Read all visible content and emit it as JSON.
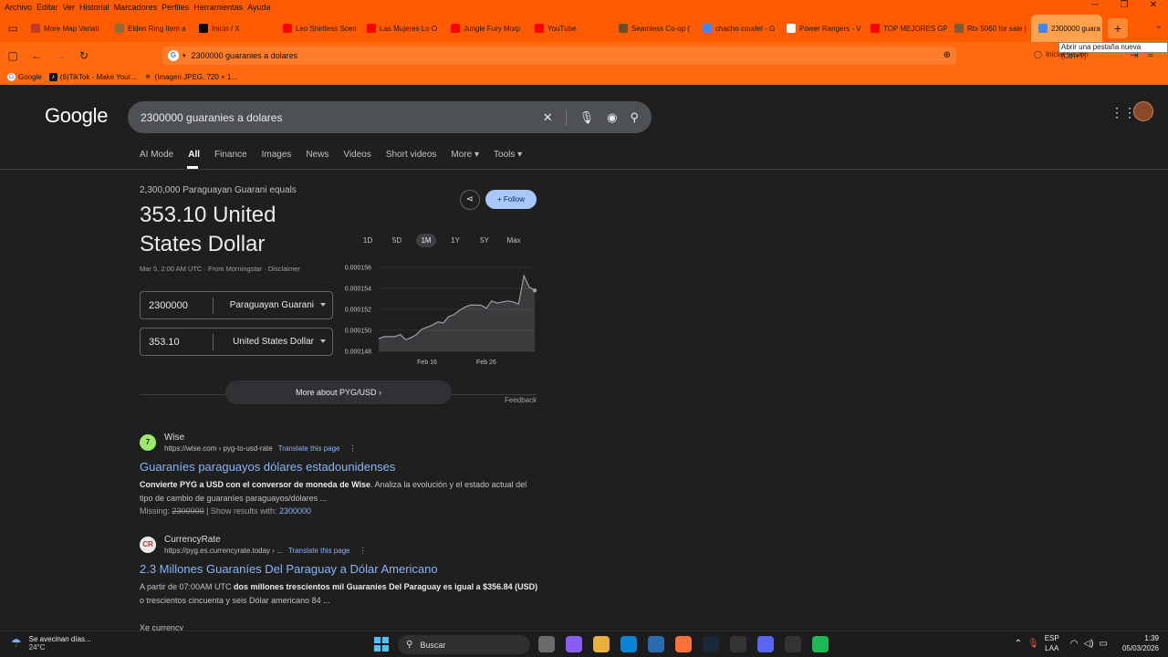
{
  "menubar": {
    "items": [
      "Archivo",
      "Editar",
      "Ver",
      "Historial",
      "Marcadores",
      "Perfiles",
      "Herramientas",
      "Ayuda"
    ]
  },
  "tabs": [
    {
      "label": "More Map Variati",
      "color": "#c0392b"
    },
    {
      "label": "Elden Ring Item a",
      "color": "#8e6b3a"
    },
    {
      "label": "Inicio / X",
      "color": "#000000"
    },
    {
      "label": "Leo Shirtless Scen",
      "color": "#ff0000"
    },
    {
      "label": "Las Mujeres Lo O",
      "color": "#ff0000"
    },
    {
      "label": "Jungle Fury Morp",
      "color": "#ff0000"
    },
    {
      "label": "YouTube",
      "color": "#ff0000"
    },
    {
      "label": "Seamless Co-op (",
      "color": "#6b4f2a"
    },
    {
      "label": "chacho coudet - G",
      "color": "#4285f4"
    },
    {
      "label": "Power Rangers - V",
      "color": "#ffffff"
    },
    {
      "label": "TOP MEJORES GP",
      "color": "#ff0000"
    },
    {
      "label": "Rtx 5060 for sale |",
      "color": "#7a5b3a"
    },
    {
      "label": "2300000 guara",
      "color": "#4285f4",
      "active": true
    }
  ],
  "tooltip": "Abrir una pestaña nueva (Ctrl+T)",
  "address": {
    "url": "2300000 guaranies a dolares"
  },
  "signin": "Iniciar sesión",
  "bookmarks": [
    {
      "label": "Google",
      "icon": "G"
    },
    {
      "label": "(6)TikTok - Make Your...",
      "icon": "♪"
    },
    {
      "label": "(Imagen JPEG, 720 × 1...",
      "icon": "⊕"
    }
  ],
  "google": {
    "logo": "Google",
    "query": "2300000 guaranies a dolares",
    "tabs": [
      "AI Mode",
      "All",
      "Finance",
      "Images",
      "News",
      "Videos",
      "Short videos",
      "More ▾",
      "Tools ▾"
    ]
  },
  "converter": {
    "equals": "2,300,000 Paraguayan Guarani equals",
    "result": "353.10 United States Dollar",
    "meta": "Mar 5, 2:00 AM UTC · From Morningstar · Disclaimer",
    "from_amount": "2300000",
    "from_currency": "Paraguayan Guarani",
    "to_amount": "353.10",
    "to_currency": "United States Dollar",
    "follow": "Follow",
    "ranges": [
      "1D",
      "5D",
      "1M",
      "1Y",
      "5Y",
      "Max"
    ],
    "selected_range": "1M",
    "more": "More about PYG/USD",
    "feedback": "Feedback"
  },
  "chart_data": {
    "type": "area",
    "title": "",
    "xlabel": "",
    "ylabel": "",
    "x_ticks": [
      "Feb 16",
      "Feb 26"
    ],
    "y_ticks": [
      "0.000156",
      "0.000154",
      "0.000152",
      "0.000150",
      "0.000148"
    ],
    "ylim": [
      0.000148,
      0.000156
    ],
    "series": [
      {
        "name": "",
        "values": [
          0.0001492,
          0.0001494,
          0.0001494,
          0.0001494,
          0.0001496,
          0.0001491,
          0.0001493,
          0.0001496,
          0.0001501,
          0.0001503,
          0.0001505,
          0.0001508,
          0.0001507,
          0.0001513,
          0.0001515,
          0.0001519,
          0.0001522,
          0.0001524,
          0.0001524,
          0.0001524,
          0.0001521,
          0.0001528,
          0.0001526,
          0.0001527,
          0.0001528,
          0.0001527,
          0.0001525,
          0.0001552,
          0.0001541,
          0.0001538
        ]
      }
    ]
  },
  "results": [
    {
      "site": "Wise",
      "url": "https://wise.com › pyg-to-usd-rate",
      "translate": "Translate this page",
      "title": "Guaraníes paraguayos dólares estadounidenses",
      "snippet_bold": "Convierte PYG a USD con el conversor de moneda de Wise",
      "snippet_rest": ". Analiza la evolución y el estado actual del tipo de cambio de guaraníes paraguayos/dólares ...",
      "missing_label": "Missing:",
      "missing_value": "2300000",
      "show_label": "| Show results with:",
      "show_value": "2300000",
      "icon": "7",
      "icon_bg": "#9fe870",
      "icon_fg": "#163300"
    },
    {
      "site": "CurrencyRate",
      "url": "https://pyg.es.currencyrate.today › ...",
      "translate": "Translate this page",
      "title": "2.3 Millones Guaraníes Del Paraguay a Dólar Americano",
      "snippet_a": "A partir de 07:00AM UTC ",
      "snippet_bold": "dos millones trescientos mil Guaraníes Del Paraguay es igual a $356.84 (USD)",
      "snippet_rest": " o trescientos cincuenta y seis Dólar americano 84 ...",
      "icon": "CR",
      "icon_bg": "#e8eaed",
      "icon_fg": "#c0392b"
    }
  ],
  "result3_partial": "Xe currency",
  "taskbar": {
    "weather_text": "Se avecinan días...",
    "temp": "24°C",
    "search": "Buscar",
    "lang_top": "ESP",
    "lang_bottom": "LAA",
    "time": "1:39",
    "date": "05/03/2026",
    "app_icon_colors": [
      "#6b6b6b",
      "#8a5cf6",
      "#e8b23a",
      "#0a84d6",
      "#2b6cb0",
      "#ff7139",
      "#1b2838",
      "#333333",
      "#5865f2",
      "#333333",
      "#1db954"
    ]
  }
}
